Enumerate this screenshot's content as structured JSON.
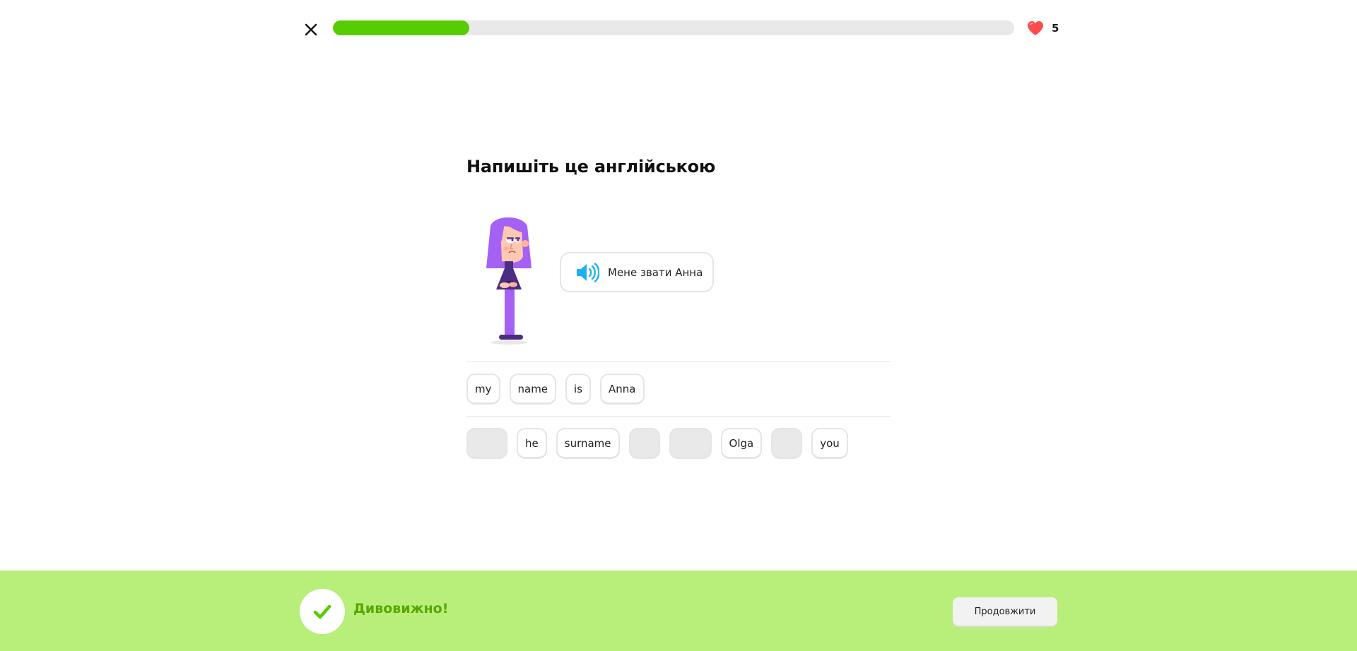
{
  "header": {
    "close_icon": "close-icon",
    "progress_fraction": 0.2,
    "hearts_icon": "heart-icon",
    "hearts_count": "5"
  },
  "challenge": {
    "title": "Напишіть це англійською",
    "speaker_icon": "speaker-icon",
    "sentence": "Мене звати Анна"
  },
  "answer_tiles": [
    "my",
    "name",
    "is",
    "Anna"
  ],
  "word_bank": [
    {
      "text": "",
      "used": true
    },
    {
      "text": "he",
      "used": false
    },
    {
      "text": "surname",
      "used": false
    },
    {
      "text": "",
      "used": true
    },
    {
      "text": "",
      "used": true
    },
    {
      "text": "Olga",
      "used": false
    },
    {
      "text": "",
      "used": true
    },
    {
      "text": "you",
      "used": false
    }
  ],
  "feedback": {
    "icon": "check-icon",
    "message": "Дивовижно!",
    "continue_label": "Продовжити"
  },
  "colors": {
    "progress": "#58cc02",
    "heart": "#ff4b4b",
    "footer_bg": "#b8ef7a",
    "feedback_text": "#58a700",
    "character_purple": "#a560f4"
  }
}
